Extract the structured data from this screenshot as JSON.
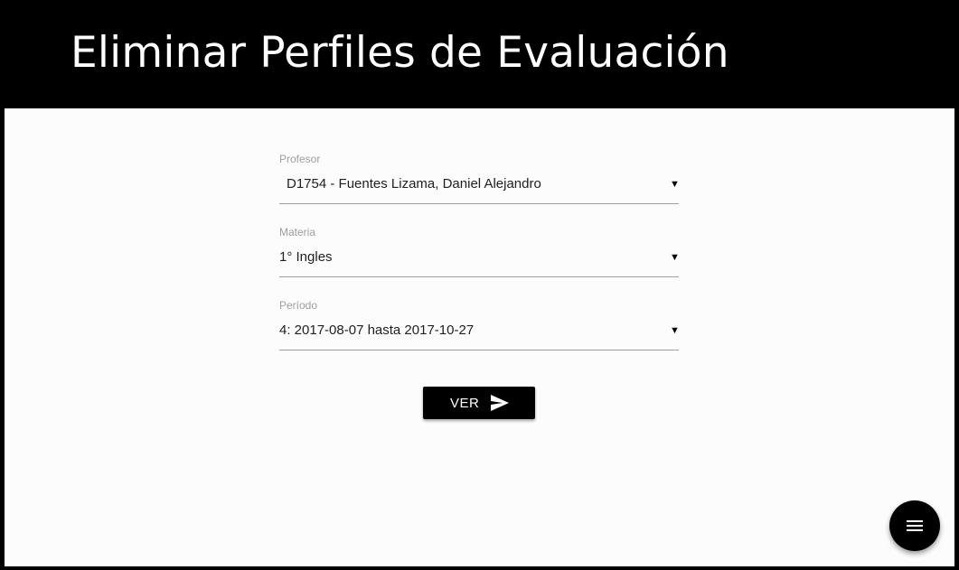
{
  "header": {
    "title": "Eliminar Perfiles de Evaluación"
  },
  "form": {
    "profesor": {
      "label": "Profesor",
      "value": "D1754 - Fuentes Lizama, Daniel Alejandro"
    },
    "materia": {
      "label": "Materia",
      "value": "1° Ingles"
    },
    "periodo": {
      "label": "Período",
      "value": "4: 2017-08-07 hasta 2017-10-27"
    },
    "arrow_glyph": "▼",
    "submit": {
      "label": "VER",
      "icon": "send-icon"
    }
  },
  "fab": {
    "icon": "menu-icon"
  },
  "colors": {
    "header_background": "#000000",
    "content_background": "#fcfcfc",
    "button_background": "#000000",
    "label_color": "#9e9e9e",
    "text_color": "#212121"
  }
}
